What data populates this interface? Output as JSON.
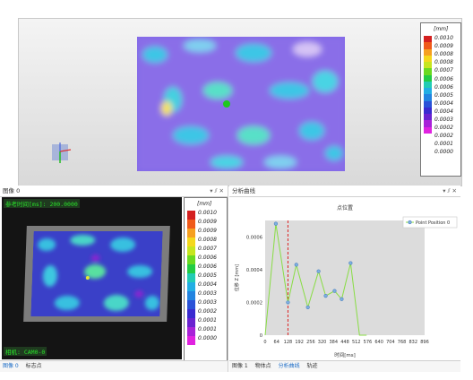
{
  "top_view": {
    "scale_unit": "[mm]",
    "scale_labels": [
      "0.0010",
      "0.0009",
      "0.0008",
      "0.0008",
      "0.0007",
      "0.0006",
      "0.0006",
      "0.0005",
      "0.0004",
      "0.0004",
      "0.0003",
      "0.0002",
      "0.0002",
      "0.0001",
      "0.0000"
    ]
  },
  "left_panel": {
    "title": "图像 0",
    "controls": "▾ ⫽ ✕",
    "overlay_top": "参考时间[ms]: 200.0000",
    "overlay_bottom": "相机: CAM0-0",
    "scale_unit": "[mm]",
    "scale_labels": [
      "0.0010",
      "0.0009",
      "0.0009",
      "0.0008",
      "0.0007",
      "0.0006",
      "0.0006",
      "0.0005",
      "0.0004",
      "0.0003",
      "0.0003",
      "0.0002",
      "0.0001",
      "0.0001",
      "0.0000"
    ],
    "tabs": [
      "图像 0",
      "标志点"
    ]
  },
  "right_panel": {
    "title": "分析曲线",
    "controls": "▾ ⫽ ✕",
    "tabs": [
      "图像 1",
      "物体点",
      "分析曲线",
      "轨迹"
    ]
  },
  "chart_data": {
    "type": "line",
    "title": "点位置",
    "xlabel": "时间[ms]",
    "ylabel": "位移 Z [mm]",
    "x": [
      0,
      64,
      128,
      192,
      256,
      320,
      384,
      448,
      512,
      576,
      640,
      704,
      768,
      832,
      896
    ],
    "xlim": [
      0,
      896
    ],
    "ylim": [
      0,
      0.0007
    ],
    "yticks": [
      "0",
      "0.0002",
      "0.0004",
      "0.0006"
    ],
    "xticks": [
      "0",
      "64",
      "128",
      "192",
      "256",
      "320",
      "384",
      "448",
      "512",
      "576",
      "640",
      "704",
      "768",
      "832",
      "896"
    ],
    "series": [
      {
        "name": "Point Position 0",
        "color": "#88dd44",
        "x": [
          0,
          60,
          128,
          175,
          240,
          300,
          340,
          390,
          430,
          480,
          530,
          570
        ],
        "y": [
          0.0,
          0.00068,
          0.0002,
          0.00043,
          0.00017,
          0.00039,
          0.00024,
          0.00027,
          0.00022,
          0.00044,
          0.0,
          0.0
        ]
      }
    ],
    "vline_x": 128,
    "grid": false,
    "legend": "top-right"
  }
}
